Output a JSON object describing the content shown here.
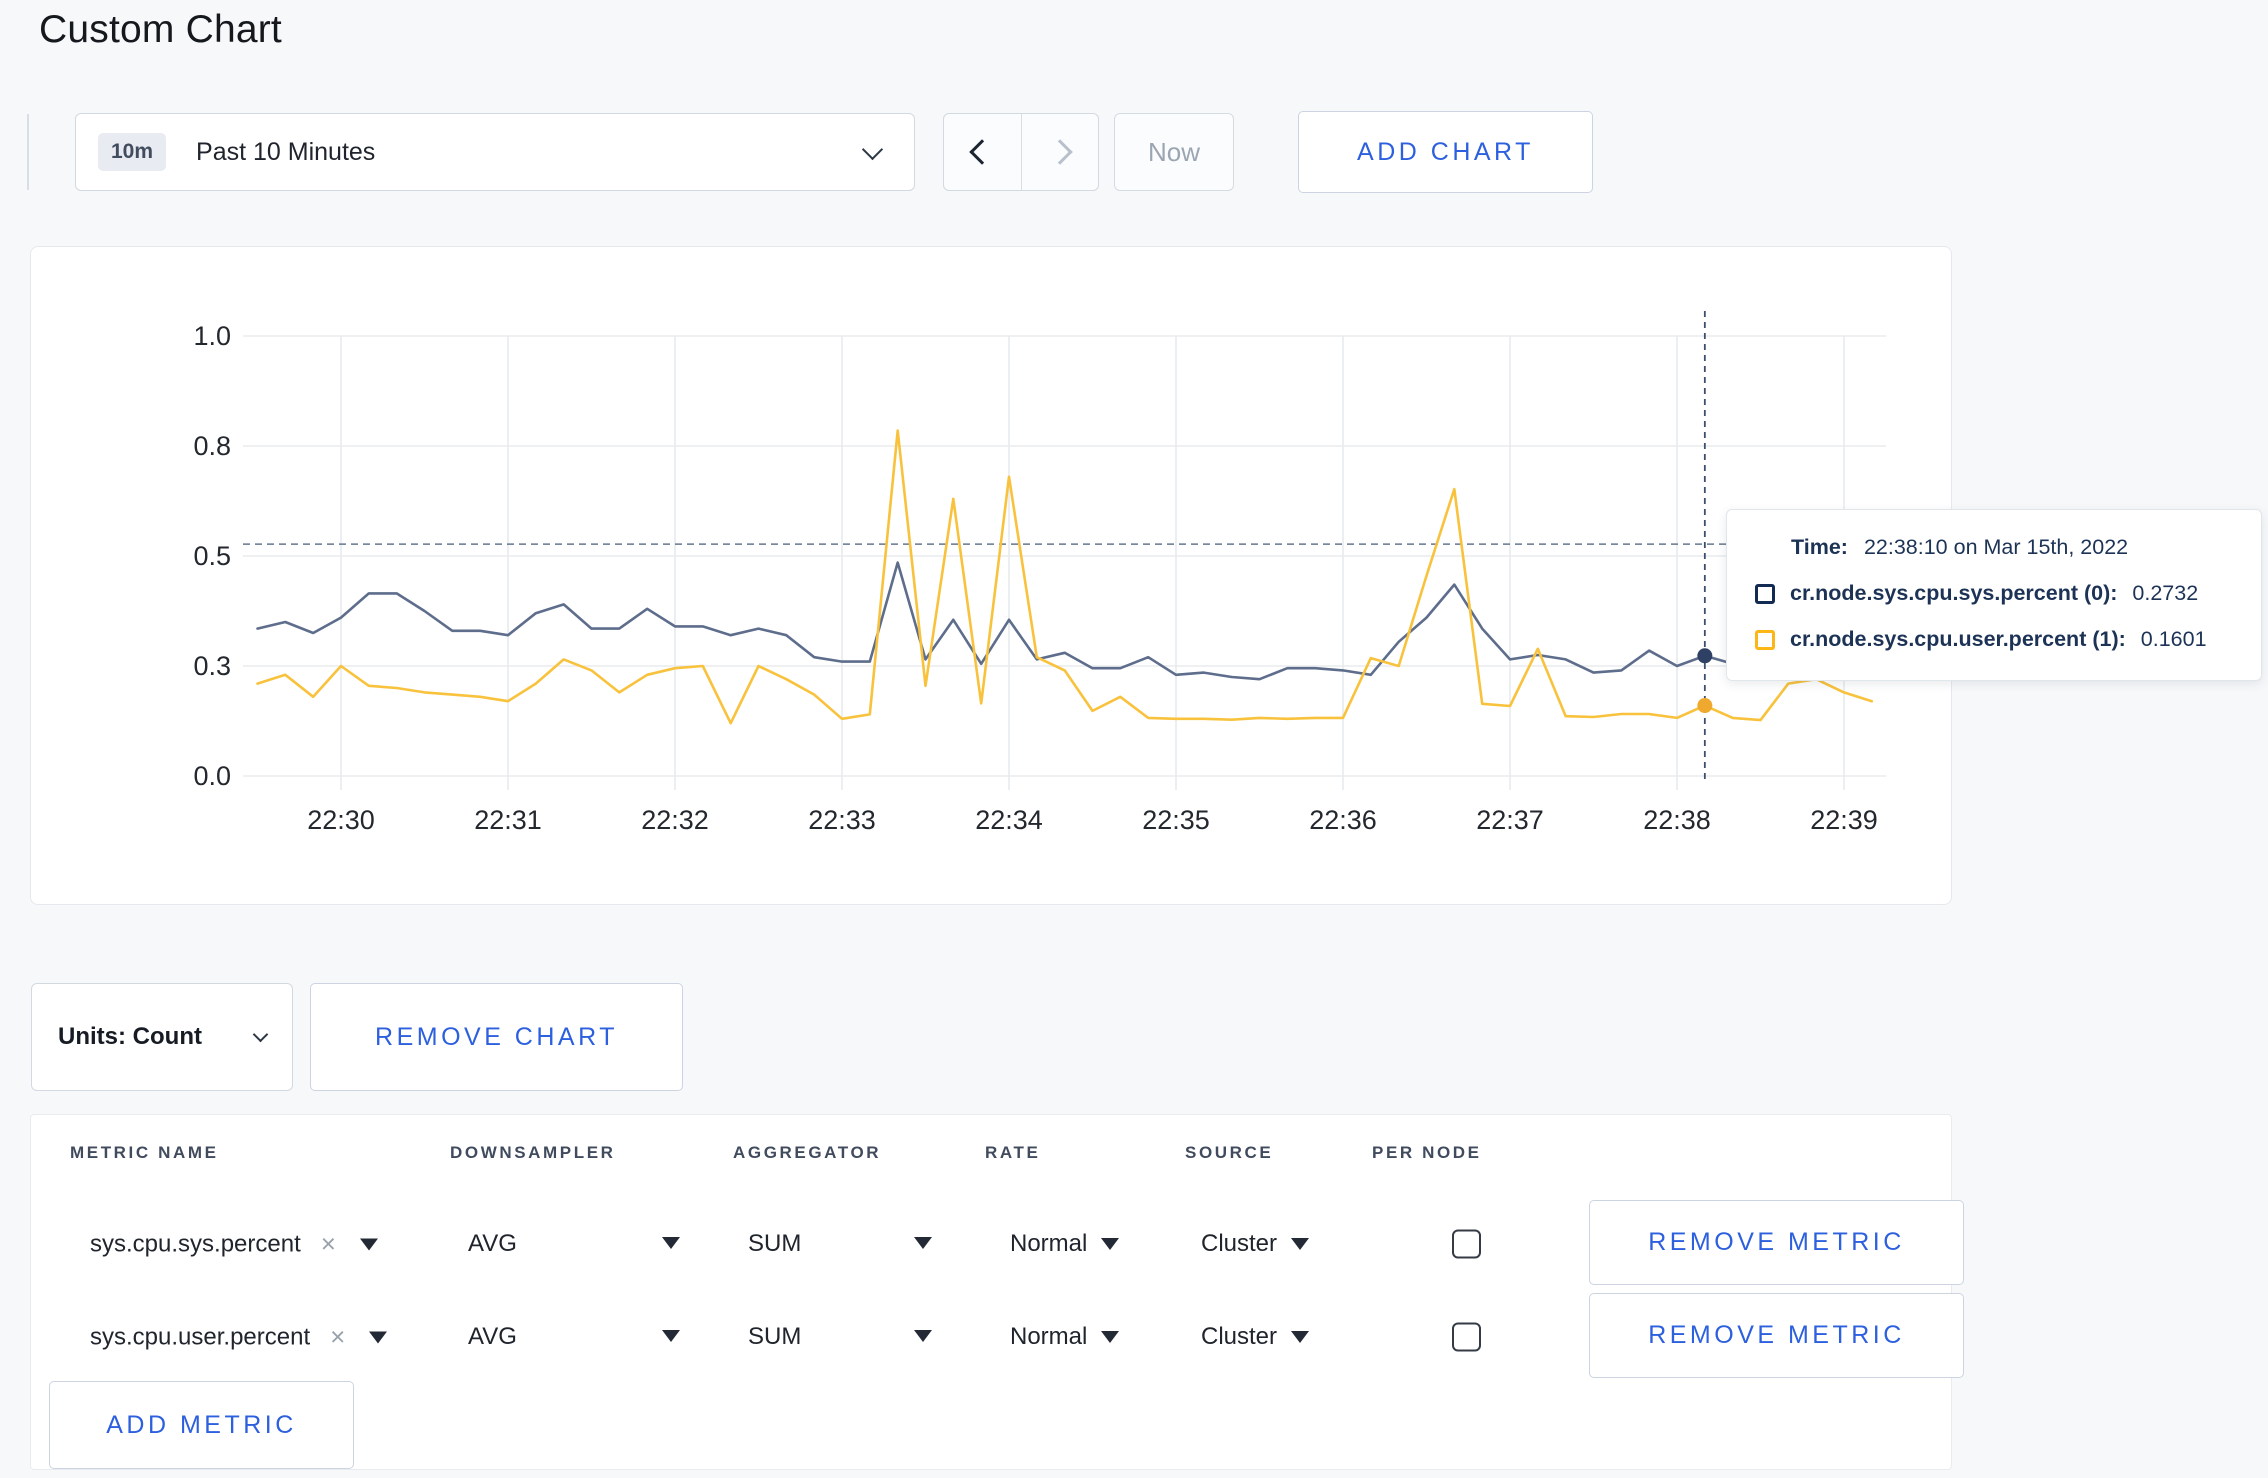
{
  "page": {
    "title": "Custom Chart"
  },
  "toolbar": {
    "range_badge": "10m",
    "range_label": "Past 10 Minutes",
    "now_label": "Now",
    "add_chart_label": "ADD CHART"
  },
  "chart_data": {
    "type": "line",
    "title": "",
    "xlabel": "",
    "ylabel": "",
    "ylim": [
      0,
      1
    ],
    "grid": true,
    "x_tick_labels": [
      "22:30",
      "22:31",
      "22:32",
      "22:33",
      "22:34",
      "22:35",
      "22:36",
      "22:37",
      "22:38",
      "22:39"
    ],
    "y_tick_labels": [
      "0.0",
      "0.3",
      "0.5",
      "0.8",
      "1.0"
    ],
    "y_tick_values": [
      0,
      0.25,
      0.5,
      0.75,
      1.0
    ],
    "point_interval_seconds": 10,
    "start_offset_seconds": -30,
    "series": [
      {
        "name": "cr.node.sys.cpu.sys.percent",
        "color": "#5d6d8b",
        "values": [
          0.335,
          0.35,
          0.325,
          0.36,
          0.415,
          0.415,
          0.375,
          0.33,
          0.33,
          0.32,
          0.37,
          0.39,
          0.335,
          0.335,
          0.38,
          0.34,
          0.34,
          0.32,
          0.335,
          0.32,
          0.27,
          0.26,
          0.26,
          0.485,
          0.265,
          0.355,
          0.255,
          0.355,
          0.265,
          0.28,
          0.245,
          0.245,
          0.27,
          0.23,
          0.235,
          0.225,
          0.22,
          0.245,
          0.245,
          0.24,
          0.23,
          0.305,
          0.36,
          0.435,
          0.335,
          0.265,
          0.275,
          0.265,
          0.235,
          0.24,
          0.285,
          0.25,
          0.2732,
          0.255,
          0.26,
          0.27,
          0.26,
          0.265,
          0.26
        ]
      },
      {
        "name": "cr.node.sys.cpu.user.percent",
        "color": "#f8c23d",
        "values": [
          0.21,
          0.23,
          0.18,
          0.25,
          0.205,
          0.2,
          0.19,
          0.185,
          0.18,
          0.17,
          0.21,
          0.265,
          0.24,
          0.19,
          0.23,
          0.245,
          0.25,
          0.12,
          0.25,
          0.22,
          0.185,
          0.13,
          0.14,
          0.785,
          0.205,
          0.63,
          0.165,
          0.68,
          0.27,
          0.24,
          0.148,
          0.18,
          0.132,
          0.13,
          0.13,
          0.128,
          0.132,
          0.13,
          0.132,
          0.132,
          0.268,
          0.25,
          0.455,
          0.652,
          0.164,
          0.159,
          0.289,
          0.136,
          0.134,
          0.141,
          0.141,
          0.132,
          0.1601,
          0.132,
          0.127,
          0.21,
          0.22,
          0.19,
          0.17
        ]
      }
    ],
    "hover_line_value": 0.527,
    "crosshair_index": 52,
    "crosshair_dot_colors": [
      "#2e4165",
      "#f0a92f"
    ],
    "legend_position": "tooltip"
  },
  "tooltip": {
    "time_label": "Time:",
    "time_value": "22:38:10 on Mar 15th, 2022",
    "rows": [
      {
        "label": "cr.node.sys.cpu.sys.percent (0):",
        "value": "0.2732",
        "swatch_color": "#132a52"
      },
      {
        "label": "cr.node.sys.cpu.user.percent (1):",
        "value": "0.1601",
        "swatch_color": "#fdb618"
      }
    ]
  },
  "chart_controls": {
    "units_label": "Units: Count",
    "remove_chart_label": "REMOVE CHART",
    "add_metric_label": "ADD METRIC"
  },
  "metrics_table": {
    "headers": [
      "METRIC NAME",
      "DOWNSAMPLER",
      "AGGREGATOR",
      "RATE",
      "SOURCE",
      "PER NODE"
    ],
    "remove_metric_label": "REMOVE METRIC",
    "rows": [
      {
        "metric": "sys.cpu.sys.percent",
        "clear": "×",
        "downsampler": "AVG",
        "aggregator": "SUM",
        "rate": "Normal",
        "source": "Cluster",
        "per_node_checked": false
      },
      {
        "metric": "sys.cpu.user.percent",
        "clear": "×",
        "downsampler": "AVG",
        "aggregator": "SUM",
        "rate": "Normal",
        "source": "Cluster",
        "per_node_checked": false
      }
    ]
  }
}
